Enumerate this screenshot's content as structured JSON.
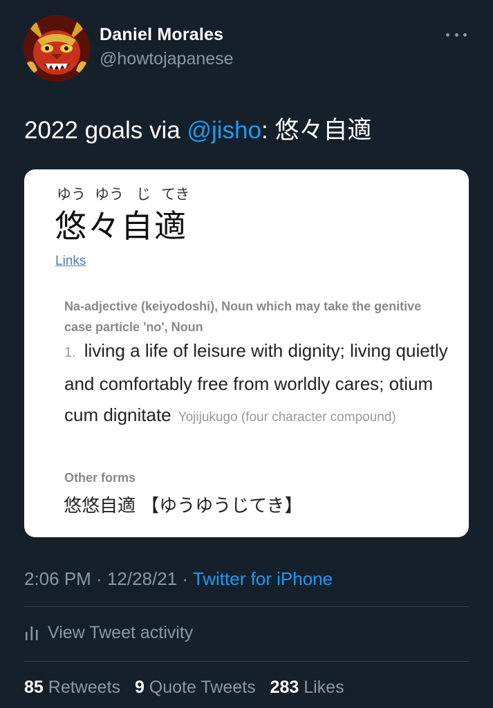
{
  "author": {
    "display_name": "Daniel Morales",
    "handle": "@howtojapanese"
  },
  "tweet": {
    "text_prefix": "2022 goals via ",
    "mention": "@jisho",
    "text_suffix": ": 悠々自適"
  },
  "card": {
    "furigana": [
      "ゆう",
      "ゆう",
      "じ",
      "てき"
    ],
    "headword": "悠々自適",
    "links_label": "Links",
    "pos_tags": "Na-adjective (keiyodoshi), Noun which may take the genitive case particle 'no', Noun",
    "meaning_number": "1.",
    "meaning_text": "living a life of leisure with dignity; living quietly and comfortably free from worldly cares; otium cum dignitate",
    "supplemental": "Yojijukugo (four character compound)",
    "other_forms_label": "Other forms",
    "other_forms_value": "悠悠自適 【ゆうゆうじてき】"
  },
  "meta": {
    "time": "2:06 PM",
    "date": "12/28/21",
    "separator": " · ",
    "source": "Twitter for iPhone"
  },
  "activity": {
    "label": "View Tweet activity",
    "icon": "bar-chart-icon"
  },
  "stats": [
    {
      "count": "85",
      "label": "Retweets"
    },
    {
      "count": "9",
      "label": "Quote Tweets"
    },
    {
      "count": "283",
      "label": "Likes"
    }
  ],
  "colors": {
    "background": "#15202b",
    "accent": "#1d9bf0",
    "secondary_text": "#8b98a5",
    "card_link": "#4a7db8"
  }
}
